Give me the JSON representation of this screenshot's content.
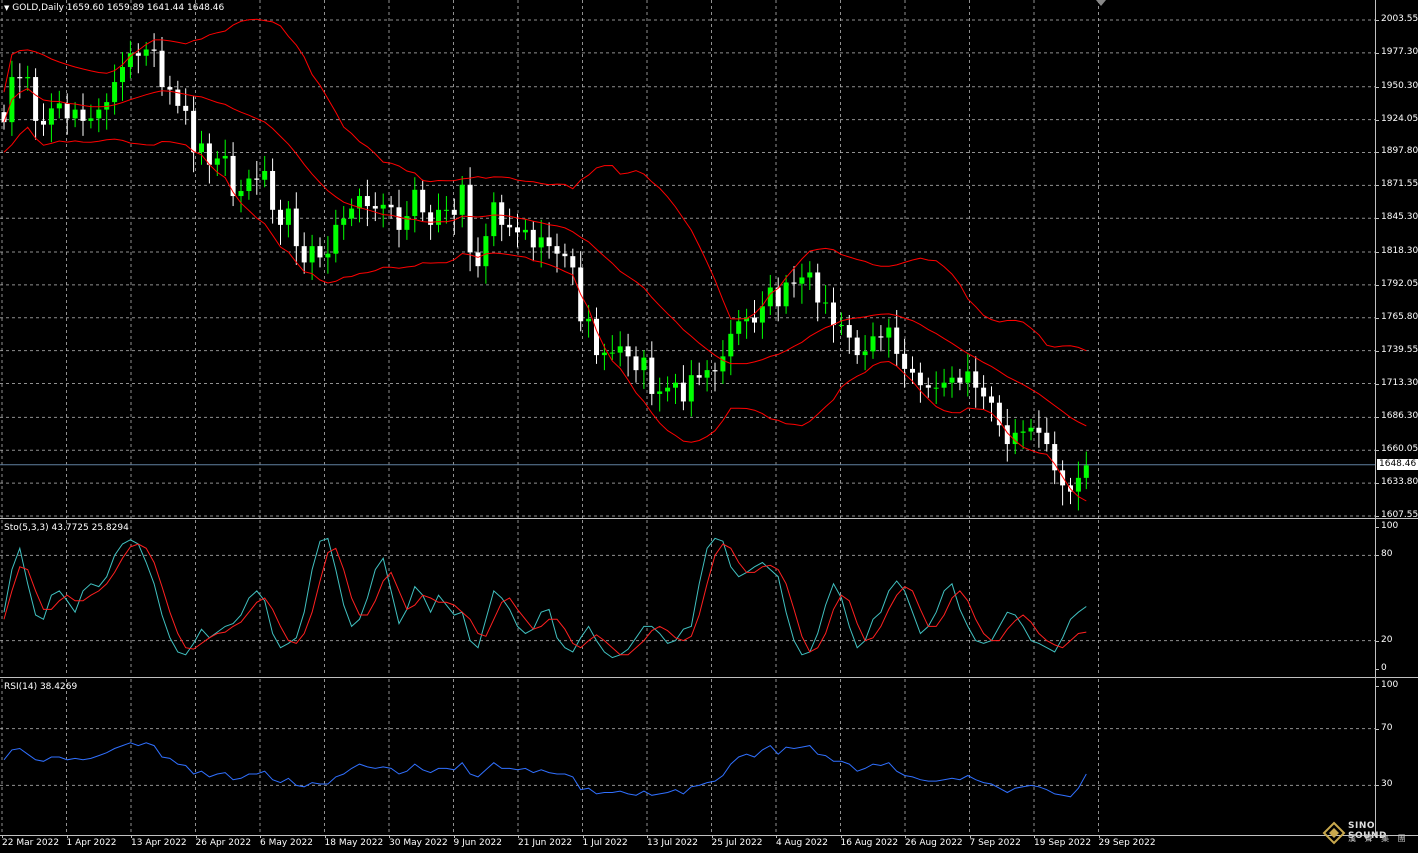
{
  "symbol_header": "GOLD,Daily  1659.60 1659.89 1641.44 1648.46",
  "stoch_header": "Sto(5,3,3) 43.7725 25.8294",
  "rsi_header": "RSI(14) 38.4269",
  "current_price": "1648.46",
  "price_axis": [
    "2003.55",
    "1977.30",
    "1950.30",
    "1924.05",
    "1897.80",
    "1871.55",
    "1845.30",
    "1818.30",
    "1792.05",
    "1765.80",
    "1739.55",
    "1713.30",
    "1686.30",
    "1660.05",
    "1633.80",
    "1607.55"
  ],
  "stoch_axis": [
    "100",
    "80",
    "20",
    "0"
  ],
  "rsi_axis": [
    "100",
    "70",
    "30"
  ],
  "date_axis": [
    "22 Mar 2022",
    "1 Apr 2022",
    "13 Apr 2022",
    "26 Apr 2022",
    "6 May 2022",
    "18 May 2022",
    "30 May 2022",
    "9 Jun 2022",
    "21 Jun 2022",
    "1 Jul 2022",
    "13 Jul 2022",
    "25 Jul 2022",
    "4 Aug 2022",
    "16 Aug 2022",
    "26 Aug 2022",
    "7 Sep 2022",
    "19 Sep 2022",
    "29 Sep 2022"
  ],
  "logo": {
    "line1": "SINO SOUND",
    "line2": "漢 聲 集 團"
  },
  "colors": {
    "background": "#000000",
    "bull_candle": "#00ff00",
    "bear_candle": "#ffffff",
    "bollinger": "#ff0000",
    "stoch_main": "#40c0c0",
    "stoch_signal": "#ff2020",
    "rsi": "#3070ff",
    "grid": "#c0c0c0"
  },
  "chart_data": [
    {
      "type": "candlestick",
      "title": "GOLD,Daily",
      "ylim": [
        1600,
        2015
      ],
      "x": [
        "22 Mar",
        "23 Mar",
        "24 Mar",
        "25 Mar",
        "28 Mar",
        "29 Mar",
        "30 Mar",
        "31 Mar",
        "1 Apr",
        "4 Apr",
        "5 Apr",
        "6 Apr",
        "7 Apr",
        "8 Apr",
        "11 Apr",
        "12 Apr",
        "13 Apr",
        "14 Apr",
        "15 Apr",
        "18 Apr",
        "19 Apr",
        "20 Apr",
        "21 Apr",
        "22 Apr",
        "25 Apr",
        "26 Apr",
        "27 Apr",
        "28 Apr",
        "29 Apr",
        "2 May",
        "3 May",
        "4 May",
        "5 May",
        "6 May",
        "9 May",
        "10 May",
        "11 May",
        "12 May",
        "13 May",
        "16 May",
        "17 May",
        "18 May",
        "19 May",
        "20 May",
        "23 May",
        "24 May",
        "25 May",
        "26 May",
        "27 May",
        "30 May",
        "31 May",
        "1 Jun",
        "2 Jun",
        "3 Jun",
        "6 Jun",
        "7 Jun",
        "8 Jun",
        "9 Jun",
        "10 Jun",
        "13 Jun",
        "14 Jun",
        "15 Jun",
        "16 Jun",
        "17 Jun",
        "20 Jun",
        "21 Jun",
        "22 Jun",
        "23 Jun",
        "24 Jun",
        "27 Jun",
        "28 Jun",
        "29 Jun",
        "30 Jun",
        "1 Jul",
        "4 Jul",
        "5 Jul",
        "6 Jul",
        "7 Jul",
        "8 Jul",
        "11 Jul",
        "12 Jul",
        "13 Jul",
        "14 Jul",
        "15 Jul",
        "18 Jul",
        "19 Jul",
        "20 Jul",
        "21 Jul",
        "22 Jul",
        "25 Jul",
        "26 Jul",
        "27 Jul",
        "28 Jul",
        "29 Jul",
        "1 Aug",
        "2 Aug",
        "3 Aug",
        "4 Aug",
        "5 Aug",
        "8 Aug",
        "9 Aug",
        "10 Aug",
        "11 Aug",
        "12 Aug",
        "15 Aug",
        "16 Aug",
        "17 Aug",
        "18 Aug",
        "19 Aug",
        "22 Aug",
        "23 Aug",
        "24 Aug",
        "25 Aug",
        "26 Aug",
        "29 Aug",
        "30 Aug",
        "31 Aug",
        "1 Sep",
        "2 Sep",
        "5 Sep",
        "6 Sep",
        "7 Sep",
        "8 Sep",
        "9 Sep",
        "12 Sep",
        "13 Sep",
        "14 Sep",
        "15 Sep",
        "16 Sep",
        "19 Sep",
        "20 Sep",
        "21 Sep",
        "22 Sep",
        "23 Sep",
        "26 Sep",
        "27 Sep",
        "28 Sep",
        "29 Sep"
      ],
      "close": [
        1922,
        1958,
        1957,
        1958,
        1923,
        1920,
        1933,
        1937,
        1925,
        1932,
        1923,
        1925,
        1932,
        1938,
        1954,
        1966,
        1977,
        1975,
        1980,
        1979,
        1950,
        1948,
        1935,
        1931,
        1898,
        1905,
        1888,
        1893,
        1895,
        1863,
        1867,
        1877,
        1876,
        1883,
        1852,
        1840,
        1853,
        1823,
        1810,
        1823,
        1814,
        1817,
        1840,
        1845,
        1853,
        1863,
        1855,
        1853,
        1856,
        1854,
        1836,
        1847,
        1868,
        1850,
        1840,
        1852,
        1852,
        1848,
        1872,
        1818,
        1807,
        1831,
        1858,
        1840,
        1838,
        1834,
        1836,
        1822,
        1830,
        1823,
        1817,
        1815,
        1806,
        1763,
        1765,
        1736,
        1738,
        1738,
        1743,
        1735,
        1724,
        1734,
        1705,
        1707,
        1710,
        1714,
        1699,
        1720,
        1718,
        1724,
        1723,
        1735,
        1753,
        1763,
        1766,
        1762,
        1775,
        1790,
        1775,
        1794,
        1793,
        1798,
        1802,
        1778,
        1778,
        1760,
        1760,
        1750,
        1736,
        1739,
        1751,
        1750,
        1758,
        1737,
        1725,
        1722,
        1712,
        1710,
        1710,
        1714,
        1718,
        1714,
        1723,
        1710,
        1703,
        1698,
        1680,
        1665,
        1674,
        1675,
        1678,
        1674,
        1665,
        1644,
        1632,
        1627,
        1638,
        1648
      ]
    },
    {
      "type": "line",
      "title": "Sto(5,3,3)",
      "ylim": [
        0,
        100
      ],
      "series": [
        {
          "name": "Sto main",
          "values": [
            40,
            70,
            85,
            60,
            38,
            35,
            52,
            55,
            48,
            40,
            55,
            60,
            58,
            65,
            80,
            88,
            91,
            88,
            75,
            60,
            38,
            22,
            12,
            10,
            18,
            28,
            22,
            26,
            30,
            32,
            38,
            50,
            55,
            48,
            25,
            15,
            18,
            22,
            40,
            70,
            90,
            92,
            70,
            45,
            30,
            35,
            50,
            70,
            78,
            55,
            32,
            42,
            58,
            52,
            40,
            52,
            45,
            38,
            40,
            20,
            15,
            35,
            55,
            50,
            42,
            30,
            25,
            28,
            40,
            42,
            22,
            15,
            12,
            22,
            30,
            20,
            12,
            8,
            10,
            14,
            22,
            30,
            30,
            25,
            18,
            20,
            28,
            30,
            60,
            85,
            92,
            90,
            72,
            65,
            68,
            72,
            75,
            70,
            65,
            40,
            20,
            10,
            12,
            25,
            45,
            60,
            50,
            30,
            15,
            20,
            35,
            40,
            55,
            62,
            55,
            40,
            25,
            30,
            40,
            55,
            60,
            42,
            30,
            20,
            18,
            20,
            30,
            40,
            38,
            30,
            20,
            18,
            15,
            12,
            22,
            35,
            40,
            44
          ]
        },
        {
          "name": "Sto signal",
          "values": [
            35,
            55,
            72,
            70,
            55,
            42,
            42,
            48,
            52,
            48,
            48,
            52,
            55,
            60,
            68,
            78,
            86,
            88,
            85,
            75,
            58,
            40,
            25,
            15,
            14,
            18,
            22,
            25,
            26,
            30,
            33,
            40,
            47,
            50,
            42,
            30,
            20,
            18,
            25,
            40,
            62,
            82,
            85,
            70,
            50,
            38,
            38,
            48,
            62,
            68,
            55,
            42,
            45,
            52,
            50,
            47,
            47,
            45,
            40,
            35,
            25,
            23,
            35,
            47,
            50,
            42,
            35,
            28,
            30,
            35,
            35,
            28,
            18,
            15,
            20,
            24,
            20,
            15,
            10,
            10,
            15,
            20,
            27,
            30,
            27,
            22,
            20,
            23,
            38,
            60,
            80,
            88,
            85,
            75,
            68,
            68,
            72,
            73,
            70,
            60,
            42,
            23,
            12,
            15,
            25,
            42,
            52,
            48,
            32,
            20,
            22,
            30,
            42,
            52,
            58,
            55,
            42,
            30,
            30,
            38,
            50,
            55,
            48,
            35,
            25,
            20,
            20,
            28,
            34,
            38,
            33,
            25,
            20,
            17,
            15,
            20,
            25,
            26
          ]
        }
      ]
    },
    {
      "type": "line",
      "title": "RSI(14)",
      "ylim": [
        0,
        100
      ],
      "series": [
        {
          "name": "RSI(14)",
          "values": [
            48,
            55,
            56,
            52,
            48,
            47,
            50,
            50,
            48,
            49,
            48,
            49,
            51,
            53,
            56,
            58,
            60,
            58,
            60,
            58,
            50,
            49,
            45,
            44,
            38,
            40,
            36,
            38,
            39,
            34,
            35,
            38,
            38,
            40,
            34,
            32,
            35,
            30,
            29,
            32,
            31,
            31,
            36,
            38,
            42,
            45,
            43,
            42,
            43,
            42,
            38,
            40,
            45,
            41,
            39,
            42,
            42,
            41,
            46,
            38,
            36,
            41,
            46,
            42,
            42,
            41,
            42,
            39,
            41,
            39,
            38,
            38,
            36,
            27,
            28,
            24,
            25,
            25,
            26,
            24,
            23,
            26,
            23,
            24,
            25,
            27,
            24,
            29,
            30,
            32,
            33,
            37,
            45,
            50,
            52,
            50,
            55,
            58,
            52,
            57,
            56,
            57,
            58,
            52,
            51,
            47,
            47,
            45,
            40,
            42,
            45,
            44,
            46,
            40,
            37,
            36,
            34,
            33,
            33,
            34,
            35,
            34,
            37,
            34,
            32,
            31,
            28,
            25,
            28,
            29,
            30,
            29,
            27,
            24,
            23,
            22,
            28,
            38
          ]
        }
      ]
    }
  ]
}
